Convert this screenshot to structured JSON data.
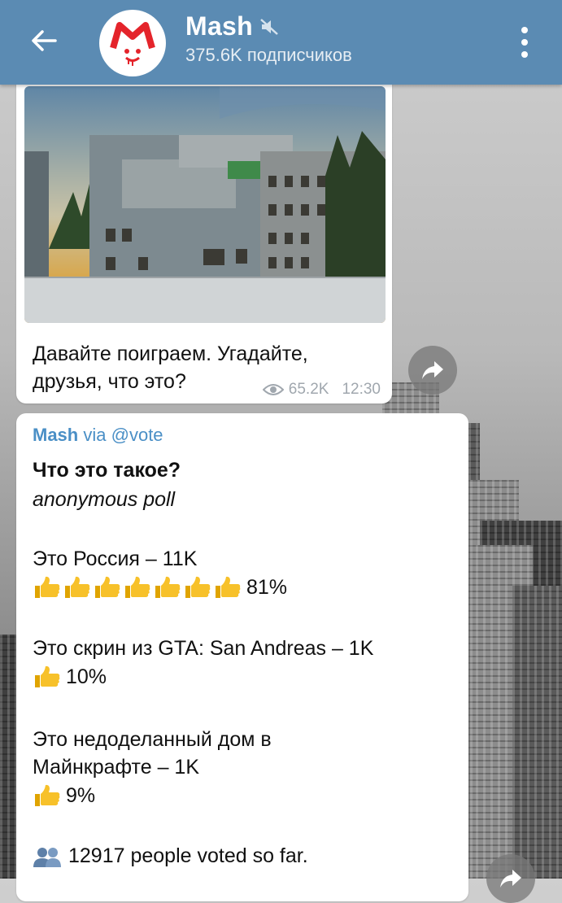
{
  "channel": {
    "name": "Mash",
    "subscribers": "375.6K подписчиков",
    "accent": "#5b8bb3"
  },
  "message1": {
    "caption": "Давайте поиграем. Угадайте, друзья, что это?",
    "views": "65.2K",
    "time": "12:30"
  },
  "message2": {
    "via_name": "Mash",
    "via_word": "via",
    "via_bot": "@vote",
    "question": "Что это такое?",
    "poll_type": "anonymous poll",
    "options": [
      {
        "label": "Это Россия – 11K",
        "thumbs": 7,
        "percent": "81%"
      },
      {
        "label": "Это скрин из GTA: San Andreas – 1K",
        "thumbs": 1,
        "percent": "10%"
      },
      {
        "label": "Это недоделанный дом в Майнкрафте – 1K",
        "thumbs": 1,
        "percent": "9%"
      }
    ],
    "voted": "12917 people voted so far."
  },
  "icons": {
    "back": "arrow-left-icon",
    "mute": "muted-speaker-icon",
    "menu": "more-vertical-icon",
    "views": "eye-icon",
    "share": "share-arrow-icon",
    "thumb": "thumbs-up-icon",
    "people": "people-icon"
  }
}
